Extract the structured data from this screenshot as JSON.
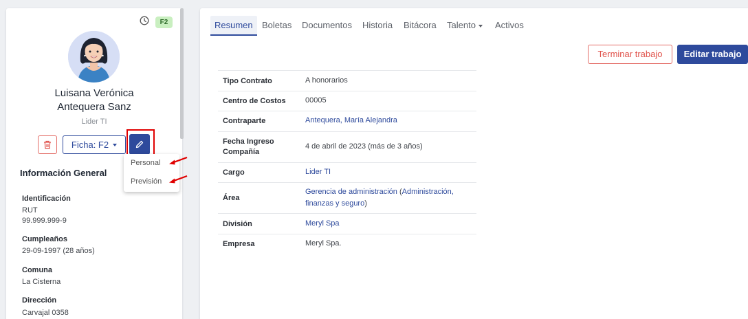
{
  "profile": {
    "badge": "F2",
    "name_line1": "Luisana Verónica",
    "name_line2": "Antequera Sanz",
    "role": "Lider TI",
    "ficha_label": "Ficha: F2",
    "icons": [
      "clock-icon",
      "trash-icon",
      "pencil-icon",
      "chevron-down-icon"
    ]
  },
  "ficha_menu": {
    "items": [
      "Personal",
      "Previsión"
    ]
  },
  "info_general": {
    "title": "Información General",
    "fields": [
      {
        "label": "Identificación",
        "value_line1": "RUT",
        "value_line2": "99.999.999-9"
      },
      {
        "label": "Cumpleaños",
        "value": "29-09-1997 (28 años)"
      },
      {
        "label": "Comuna",
        "value": "La Cisterna"
      },
      {
        "label": "Dirección",
        "value": "Carvajal 0358"
      }
    ]
  },
  "tabs": [
    {
      "label": "Resumen",
      "active": true
    },
    {
      "label": "Boletas"
    },
    {
      "label": "Documentos"
    },
    {
      "label": "Historia"
    },
    {
      "label": "Bitácora"
    },
    {
      "label": "Talento"
    },
    {
      "label": "Activos"
    }
  ],
  "actions": {
    "terminar": "Terminar trabajo",
    "editar": "Editar trabajo"
  },
  "summary": [
    {
      "label": "Tipo Contrato",
      "value": "A honorarios"
    },
    {
      "label": "Centro de Costos",
      "value": "00005"
    },
    {
      "label": "Contraparte",
      "value": "Antequera, María Alejandra"
    },
    {
      "label_line1": "Fecha Ingreso",
      "label_line2": "Compañía",
      "value": "4 de abril de 2023 (más de 3 años)"
    },
    {
      "label": "Cargo",
      "value": "Lider TI"
    },
    {
      "label": "Área",
      "value_link1": "Gerencia de administración",
      "value_paren_open": " (",
      "value_link2_line1": "Administración,",
      "value_link2_line2": "finanzas y seguro",
      "value_paren_close": ")"
    },
    {
      "label": "División",
      "value": "Meryl Spa"
    },
    {
      "label": "Empresa",
      "value": "Meryl Spa."
    }
  ],
  "colors": {
    "primary": "#2e4a9c",
    "danger": "#e0524b",
    "badge_bg": "#c9efc0",
    "highlight": "#e00000"
  }
}
